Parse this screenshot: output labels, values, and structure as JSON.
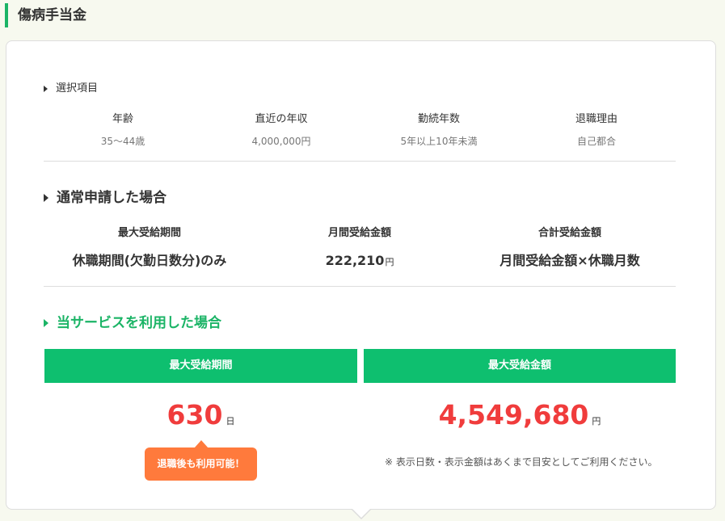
{
  "page": {
    "title": "傷病手当金"
  },
  "selection": {
    "heading": "選択項目",
    "items": [
      {
        "label": "年齢",
        "value": "35～44歳"
      },
      {
        "label": "直近の年収",
        "value": "4,000,000円"
      },
      {
        "label": "勤続年数",
        "value": "5年以上10年未満"
      },
      {
        "label": "退職理由",
        "value": "自己都合"
      }
    ]
  },
  "normal": {
    "title": "通常申請した場合",
    "period_label": "最大受給期間",
    "period_value": "休職期間(欠勤日数分)のみ",
    "monthly_label": "月間受給金額",
    "monthly_value": "222,210",
    "monthly_unit": "円",
    "total_label": "合計受給金額",
    "total_value": "月間受給金額×休職月数"
  },
  "service": {
    "title": "当サービスを利用した場合",
    "period_label": "最大受給期間",
    "period_value": "630",
    "period_unit": "日",
    "amount_label": "最大受給金額",
    "amount_value": "4,549,680",
    "amount_unit": "円",
    "badge": "退職後も利用可能！",
    "note": "※ 表示日数・表示金額はあくまで目安としてご利用ください。"
  },
  "colors": {
    "accent_green": "#0ebf6f",
    "heading_green": "#1bb466",
    "value_red": "#f03c3c",
    "badge_orange": "#ff7a3c"
  },
  "icons": [
    "caret-right-icon"
  ]
}
